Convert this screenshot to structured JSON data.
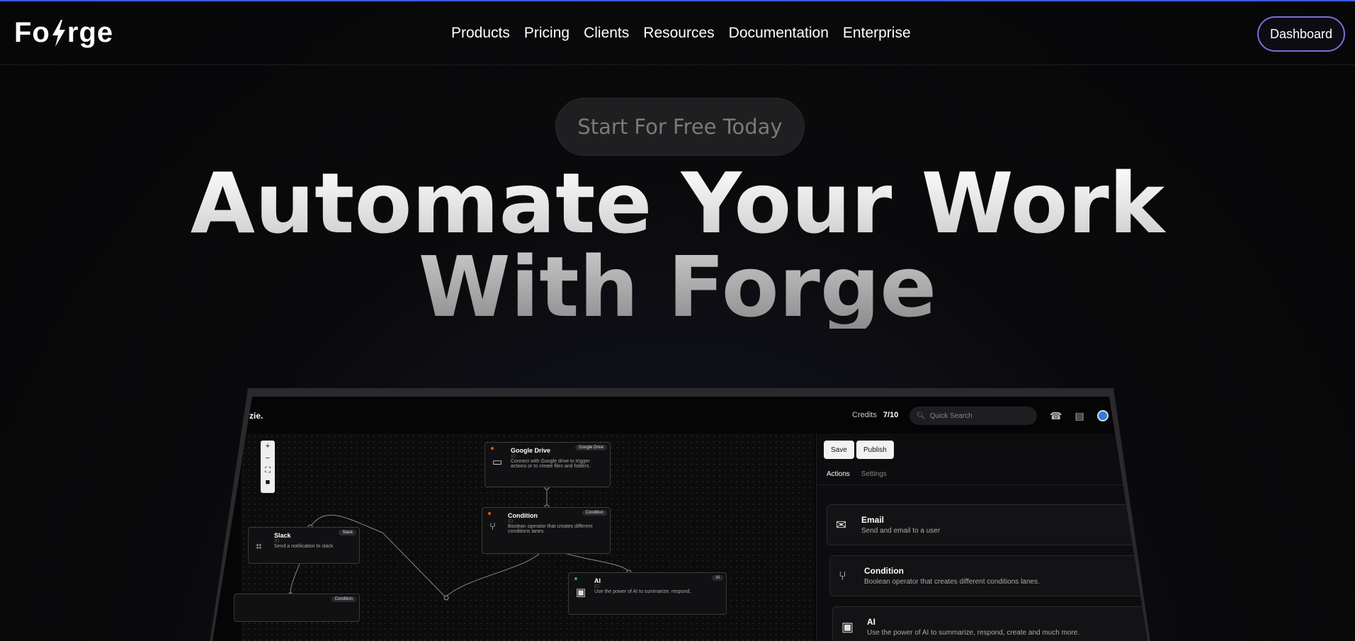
{
  "header": {
    "logo_left": "Fo",
    "logo_right": "rge",
    "nav": [
      "Products",
      "Pricing",
      "Clients",
      "Resources",
      "Documentation",
      "Enterprise"
    ],
    "dashboard_label": "Dashboard"
  },
  "hero": {
    "cta_label": "Start For Free Today",
    "line1": "Automate Your Work",
    "line2": "With Forge"
  },
  "app": {
    "logo": "zie.",
    "credits_label": "Credits",
    "credits_value": "7/10",
    "search_placeholder": "Quick Search",
    "save_label": "Save",
    "publish_label": "Publish",
    "tabs": [
      "Actions",
      "Settings"
    ],
    "nodes": [
      {
        "title": "Google Drive",
        "tag": "Google Drive",
        "id": "ID:",
        "desc": "Connect with Google drive to trigger actions or to create files and folders.",
        "dot": "#e8590c"
      },
      {
        "title": "Condition",
        "tag": "Condition",
        "id": "ID:",
        "desc": "Boolean operator that creates different conditions lanes.",
        "dot": "#e8590c"
      },
      {
        "title": "Slack",
        "tag": "Slack",
        "id": "ID:",
        "desc": "Send a notification to slack",
        "dot": ""
      },
      {
        "title": "AI",
        "tag": "AI",
        "id": "ID:",
        "desc": "Use the power of AI to summarize, respond,",
        "dot": "#2fb344"
      },
      {
        "title": "",
        "tag": "Condition",
        "id": "",
        "desc": "",
        "dot": ""
      }
    ],
    "actions": [
      {
        "title": "Email",
        "desc": "Send and email to a user",
        "icon": "mail-icon"
      },
      {
        "title": "Condition",
        "desc": "Boolean operator that creates different conditions lanes.",
        "icon": "branch-icon"
      },
      {
        "title": "AI",
        "desc": "Use the power of AI to summarize, respond, create and much more.",
        "icon": "ai-icon"
      }
    ]
  },
  "colors": {
    "accent_line": "#3b5bdb",
    "dashboard_border": "#7c6fd8"
  }
}
